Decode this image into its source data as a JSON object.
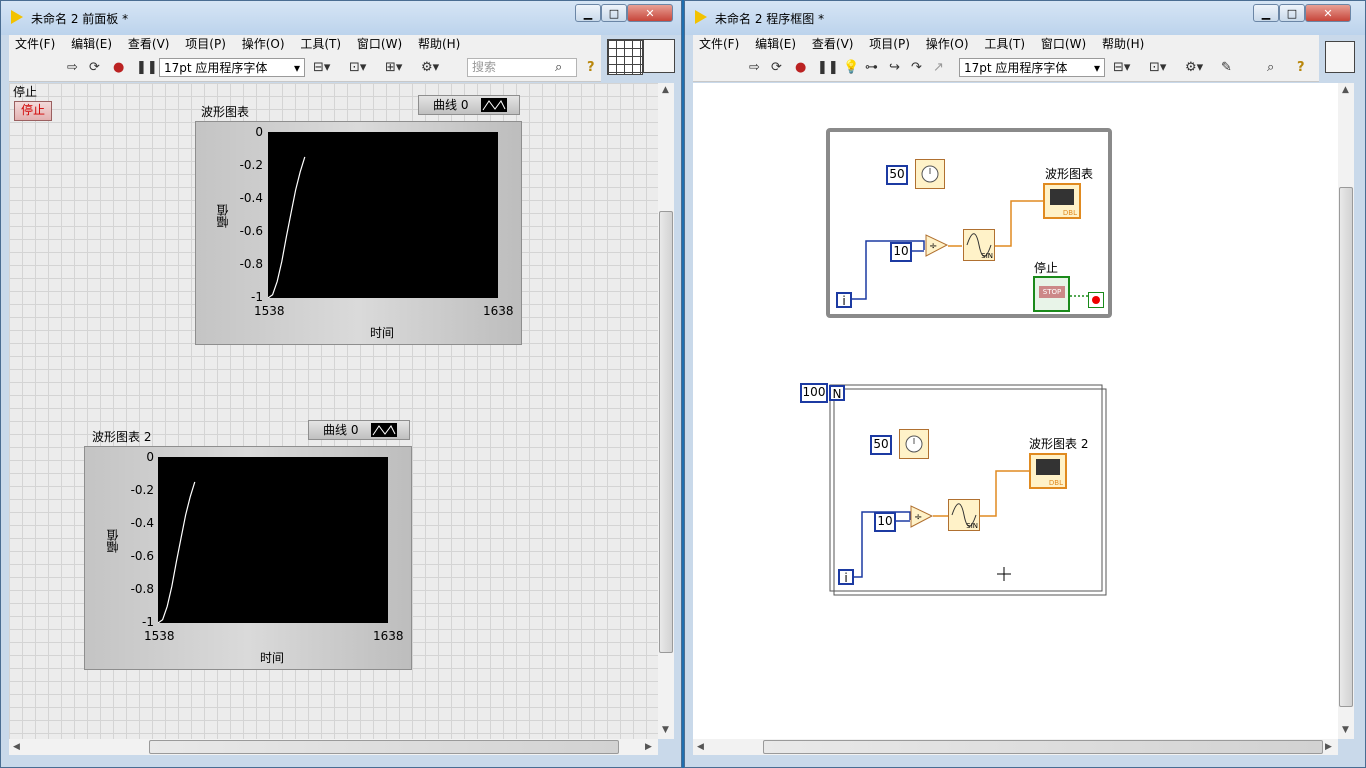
{
  "front_panel": {
    "title": "未命名 2 前面板 *",
    "menu": [
      "文件(F)",
      "编辑(E)",
      "查看(V)",
      "项目(P)",
      "操作(O)",
      "工具(T)",
      "窗口(W)",
      "帮助(H)"
    ],
    "font": "17pt 应用程序字体",
    "search_placeholder": "搜索",
    "stop_label": "停止",
    "stop_button": "停止",
    "chart1": {
      "title": "波形图表",
      "legend": "曲线 0",
      "ylabel": "幅值",
      "xlabel": "时间",
      "yticks": [
        "0",
        "-0.2",
        "-0.4",
        "-0.6",
        "-0.8",
        "-1"
      ],
      "x_start": "1538",
      "x_end": "1638"
    },
    "chart2": {
      "title": "波形图表 2",
      "legend": "曲线 0",
      "ylabel": "幅值",
      "xlabel": "时间",
      "yticks": [
        "0",
        "-0.2",
        "-0.4",
        "-0.6",
        "-0.8",
        "-1"
      ],
      "x_start": "1538",
      "x_end": "1638"
    }
  },
  "block_diagram": {
    "title": "未命名 2 程序框图 *",
    "menu": [
      "文件(F)",
      "编辑(E)",
      "查看(V)",
      "项目(P)",
      "操作(O)",
      "工具(T)",
      "窗口(W)",
      "帮助(H)"
    ],
    "font": "17pt 应用程序字体",
    "while_loop": {
      "wait_const": "50",
      "divisor_const": "10",
      "iteration": "i",
      "chart_label": "波形图表",
      "stop_label": "停止",
      "stop_text": "STOP",
      "sin_text": "SIN",
      "dbl_text": "DBL"
    },
    "for_loop": {
      "count": "100",
      "count_terminal": "N",
      "wait_const": "50",
      "divisor_const": "10",
      "iteration": "i",
      "chart_label": "波形图表 2",
      "sin_text": "SIN",
      "dbl_text": "DBL"
    }
  },
  "chart_data": [
    {
      "type": "line",
      "title": "波形图表",
      "xlabel": "时间",
      "ylabel": "幅值",
      "xlim": [
        1538,
        1638
      ],
      "ylim": [
        -1,
        0
      ],
      "x": [
        1538,
        1540,
        1542,
        1544,
        1546,
        1548,
        1550,
        1552,
        1554
      ],
      "series": [
        {
          "name": "曲线 0",
          "values": [
            -1.0,
            -0.98,
            -0.9,
            -0.78,
            -0.63,
            -0.49,
            -0.35,
            -0.24,
            -0.15
          ]
        }
      ]
    },
    {
      "type": "line",
      "title": "波形图表 2",
      "xlabel": "时间",
      "ylabel": "幅值",
      "xlim": [
        1538,
        1638
      ],
      "ylim": [
        -1,
        0
      ],
      "x": [
        1538,
        1540,
        1542,
        1544,
        1546,
        1548,
        1550,
        1552,
        1554
      ],
      "series": [
        {
          "name": "曲线 0",
          "values": [
            -1.0,
            -0.98,
            -0.9,
            -0.78,
            -0.63,
            -0.49,
            -0.35,
            -0.24,
            -0.15
          ]
        }
      ]
    }
  ],
  "colors": {
    "wire_numeric": "#1c3aa2",
    "wire_dbl": "#e08a20",
    "wire_bool": "#1a8a1a",
    "plot_bg": "#000000",
    "trace": "#ffffff"
  }
}
